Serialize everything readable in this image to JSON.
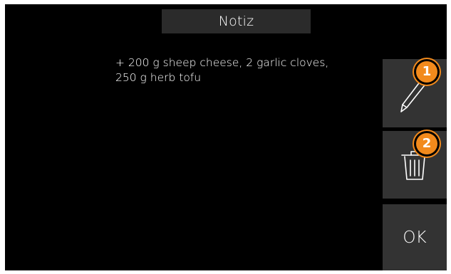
{
  "header": {
    "title": "Notiz"
  },
  "note": {
    "line1": "+ 200 g sheep cheese, 2 garlic cloves,",
    "line2": "250 g herb tofu"
  },
  "actions": {
    "edit_icon": "pen-icon",
    "delete_icon": "trash-icon",
    "ok_label": "OK"
  },
  "callouts": [
    {
      "label": "1"
    },
    {
      "label": "2"
    }
  ],
  "colors": {
    "background": "#000000",
    "button": "#333333",
    "title_bar": "#2b2b2b",
    "callout": "#f28a1c",
    "text": "#ffffff"
  }
}
